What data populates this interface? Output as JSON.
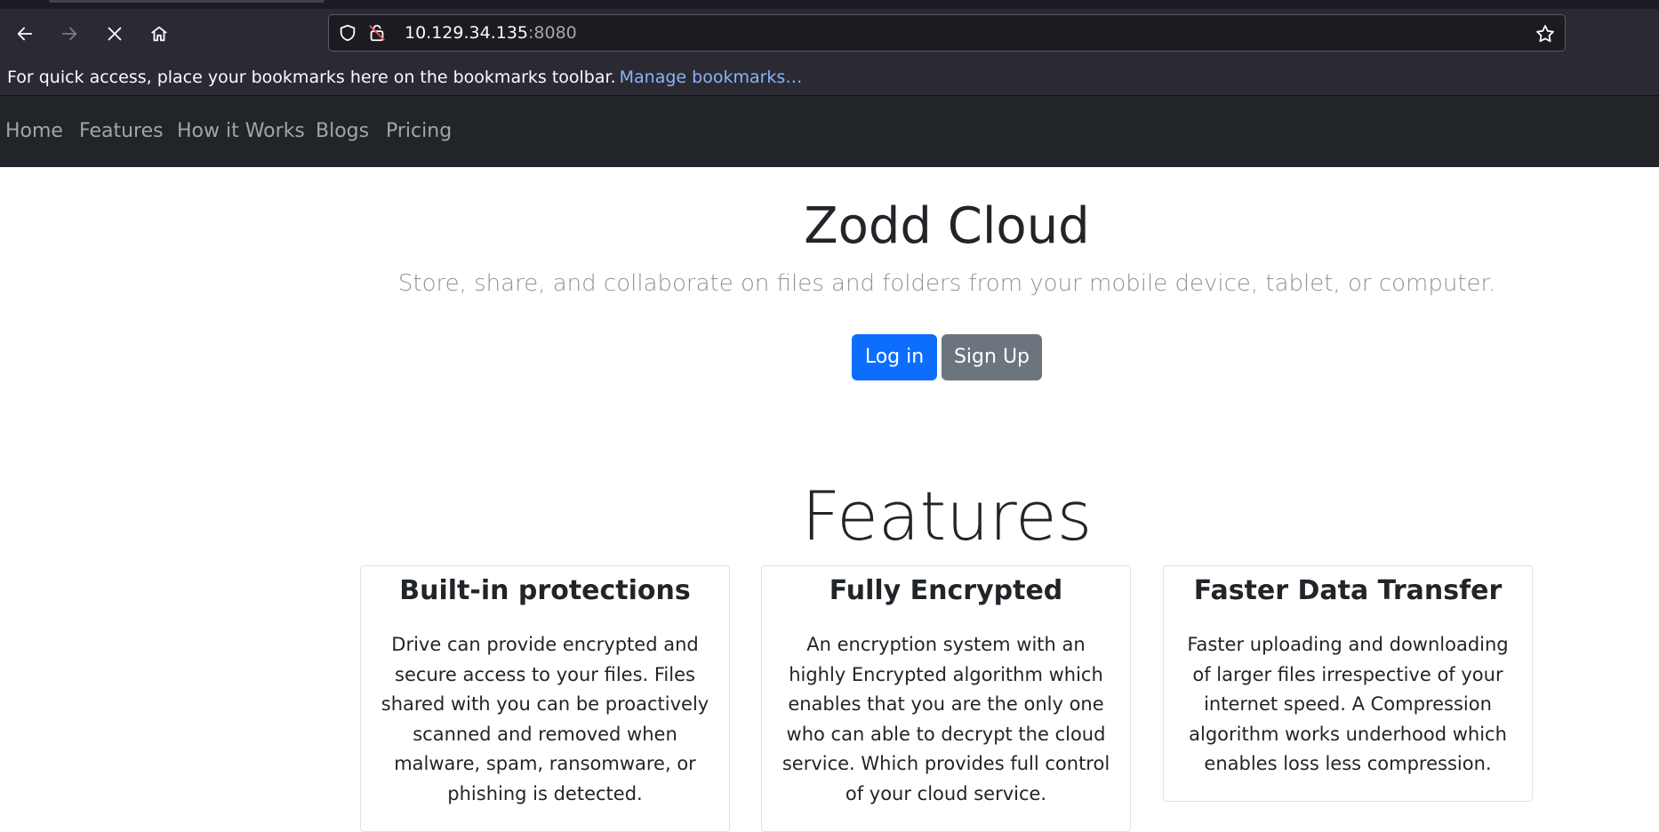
{
  "browser": {
    "url_host": "10.129.34.135",
    "url_port": ":8080",
    "bookmarks_message": "For quick access, place your bookmarks here on the bookmarks toolbar.",
    "manage_bookmarks_link": "Manage bookmarks…",
    "icons": [
      "back-icon",
      "forward-icon",
      "stop-icon",
      "home-icon",
      "shield-icon",
      "lock-icon",
      "star-icon"
    ]
  },
  "site_nav": {
    "items": [
      {
        "label": "Home"
      },
      {
        "label": "Features"
      },
      {
        "label": "How it Works"
      },
      {
        "label": "Blogs"
      },
      {
        "label": "Pricing"
      }
    ]
  },
  "hero": {
    "title": "Zodd Cloud",
    "subtitle": "Store, share, and collaborate on files and folders from your mobile device, tablet, or computer.",
    "login_label": "Log in",
    "signup_label": "Sign Up"
  },
  "features": {
    "heading": "Features",
    "cards": [
      {
        "title": "Built-in protections",
        "text": "Drive can provide encrypted and secure access to your files. Files shared with you can be proactively scanned and removed when malware, spam, ransomware, or phishing is detected."
      },
      {
        "title": "Fully Encrypted",
        "text": "An encryption system with an highly Encrypted algorithm which enables that you are the only one who can able to decrypt the cloud service. Which provides full control of your cloud service."
      },
      {
        "title": "Faster Data Transfer",
        "text": "Faster uploading and downloading of larger files irrespective of your internet speed. A Compression algorithm works underhood which enables loss less compression."
      }
    ]
  },
  "colors": {
    "nav_bg": "#212529",
    "primary": "#0d6efd",
    "secondary": "#6c757d",
    "browser_bg": "#2b2a33"
  }
}
